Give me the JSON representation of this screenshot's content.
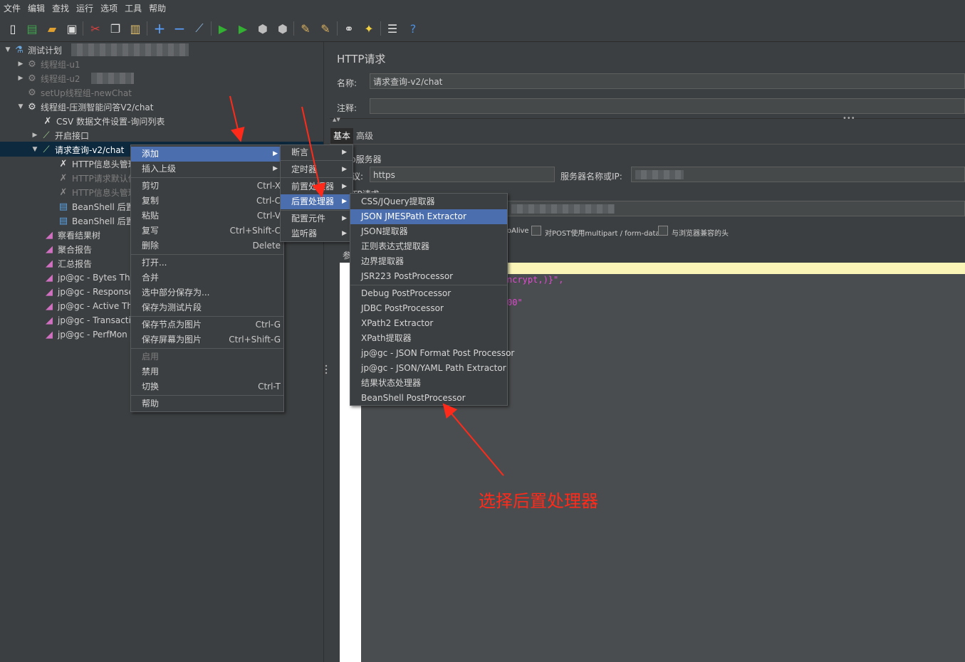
{
  "menubar": [
    "文件",
    "编辑",
    "查找",
    "运行",
    "选项",
    "工具",
    "帮助"
  ],
  "tree": {
    "nodes": [
      {
        "label": "测试计划"
      },
      {
        "label": "线程组-u1"
      },
      {
        "label": "线程组-u2"
      },
      {
        "label": "setUp线程组-newChat"
      },
      {
        "label": "线程组-压测智能问答V2/chat"
      },
      {
        "label": "CSV 数据文件设置-询问列表"
      },
      {
        "label": "开启接口"
      },
      {
        "label": "请求查询-v2/chat"
      },
      {
        "label": "HTTP信息头管理"
      },
      {
        "label": "HTTP请求默认值"
      },
      {
        "label": "HTTP信息头管理"
      },
      {
        "label": "BeanShell 后置"
      },
      {
        "label": "BeanShell 后置"
      },
      {
        "label": "察看结果树"
      },
      {
        "label": "聚合报告"
      },
      {
        "label": "汇总报告"
      },
      {
        "label": "jp@gc - Bytes Thro"
      },
      {
        "label": "jp@gc - Response"
      },
      {
        "label": "jp@gc - Active Thr"
      },
      {
        "label": "jp@gc - Transactio"
      },
      {
        "label": "jp@gc - PerfMon M"
      }
    ]
  },
  "right": {
    "title": "HTTP请求",
    "name_label": "名称:",
    "name_value": "请求查询-v2/chat",
    "comment_label": "注释:",
    "tab_basic": "基本",
    "tab_advanced": "高级",
    "web_server": "b服务器",
    "protocol_label": "议:",
    "protocol_value": "https",
    "server_label": "服务器名称或IP:",
    "http_request": "TP请求",
    "keepalive": "oAlive",
    "multipart": "对POST使用multipart / form-data",
    "browser_headers": "与浏览器兼容的头",
    "params_short": "参",
    "code_line1": "ncrypt,)}\",",
    "code_line2": "00\""
  },
  "context_menu": {
    "items": [
      {
        "label": "添加",
        "shortcut": "",
        "selected": true,
        "submenu": true
      },
      {
        "label": "插入上级",
        "shortcut": "",
        "submenu": true
      },
      {
        "label": "剪切",
        "shortcut": "Ctrl-X"
      },
      {
        "label": "复制",
        "shortcut": "Ctrl-C"
      },
      {
        "label": "粘贴",
        "shortcut": "Ctrl-V"
      },
      {
        "label": "复写",
        "shortcut": "Ctrl+Shift-C"
      },
      {
        "label": "删除",
        "shortcut": "Delete"
      },
      {
        "label": "打开..."
      },
      {
        "label": "合并"
      },
      {
        "label": "选中部分保存为..."
      },
      {
        "label": "保存为测试片段"
      },
      {
        "label": "保存节点为图片",
        "shortcut": "Ctrl-G"
      },
      {
        "label": "保存屏幕为图片",
        "shortcut": "Ctrl+Shift-G"
      },
      {
        "label": "启用",
        "disabled": true
      },
      {
        "label": "禁用"
      },
      {
        "label": "切换",
        "shortcut": "Ctrl-T"
      },
      {
        "label": "帮助"
      }
    ]
  },
  "add_submenu": {
    "items": [
      "断言",
      "定时器",
      "前置处理器",
      "后置处理器",
      "配置元件",
      "监听器"
    ],
    "selected_index": 3
  },
  "post_submenu": {
    "items": [
      "CSS/JQuery提取器",
      "JSON JMESPath Extractor",
      "JSON提取器",
      "正则表达式提取器",
      "边界提取器",
      "JSR223 PostProcessor",
      "Debug PostProcessor",
      "JDBC PostProcessor",
      "XPath2 Extractor",
      "XPath提取器",
      "jp@gc - JSON Format Post Processor",
      "jp@gc - JSON/YAML Path Extractor",
      "结果状态处理器",
      "BeanShell PostProcessor"
    ],
    "selected_index": 1
  },
  "annotation": "选择后置处理器",
  "colors": {
    "selection": "#4b6eaf",
    "annotation": "#ff2a1a",
    "background": "#3c3f41"
  }
}
